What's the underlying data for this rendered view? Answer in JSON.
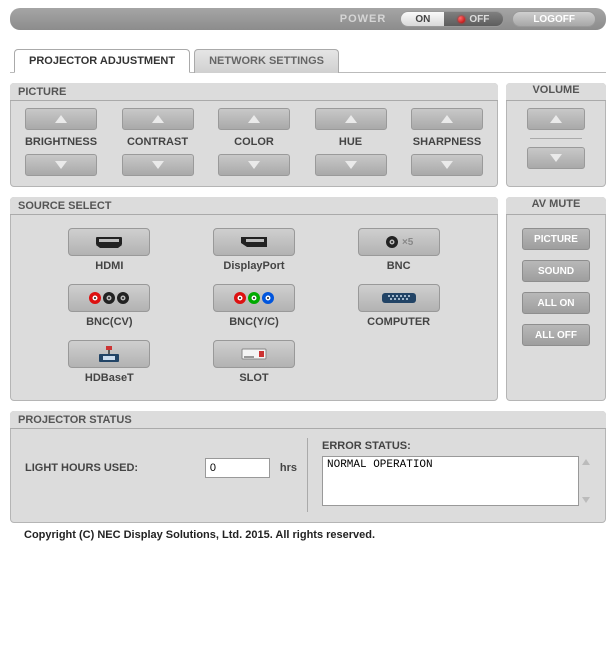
{
  "topbar": {
    "power_label": "POWER",
    "on_label": "ON",
    "off_label": "OFF",
    "logoff_label": "LOGOFF"
  },
  "tabs": {
    "adjustment": "PROJECTOR ADJUSTMENT",
    "network": "NETWORK SETTINGS"
  },
  "picture": {
    "title": "PICTURE",
    "brightness": "BRIGHTNESS",
    "contrast": "CONTRAST",
    "color": "COLOR",
    "hue": "HUE",
    "sharpness": "SHARPNESS"
  },
  "volume": {
    "title": "VOLUME"
  },
  "source": {
    "title": "SOURCE SELECT",
    "hdmi": "HDMI",
    "displayport": "DisplayPort",
    "bnc": "BNC",
    "bnccv": "BNC(CV)",
    "bncyc": "BNC(Y/C)",
    "computer": "COMPUTER",
    "hdbaset": "HDBaseT",
    "slot": "SLOT",
    "bnc_x5": "×5"
  },
  "avmute": {
    "title": "AV MUTE",
    "picture": "PICTURE",
    "sound": "SOUND",
    "allon": "ALL ON",
    "alloff": "ALL OFF"
  },
  "status": {
    "title": "PROJECTOR STATUS",
    "light_hours_label": "LIGHT HOURS USED:",
    "light_hours_value": "0",
    "hrs_unit": "hrs",
    "error_label": "ERROR STATUS:",
    "error_value": "NORMAL OPERATION"
  },
  "footer": "Copyright (C) NEC Display Solutions, Ltd. 2015. All rights reserved."
}
